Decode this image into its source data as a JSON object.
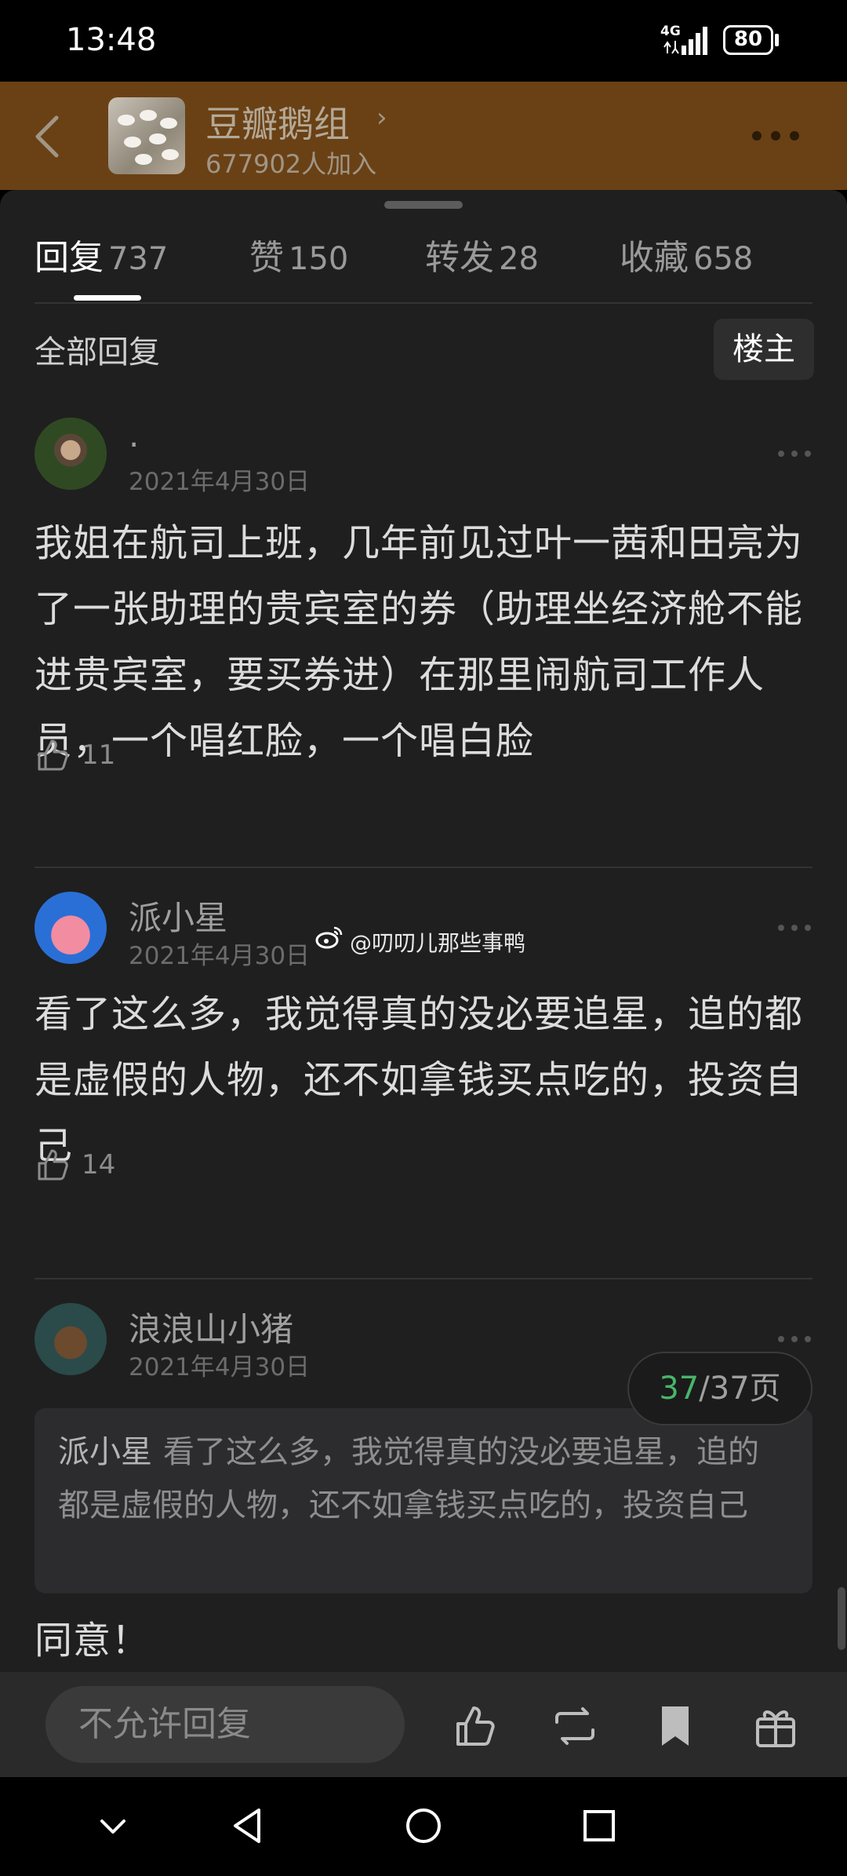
{
  "status_bar": {
    "time": "13:48",
    "network": "4G",
    "battery": "80"
  },
  "group": {
    "name": "豆瓣鹅组",
    "members": "677902人加入"
  },
  "tabs": [
    {
      "label": "回复",
      "count": "737"
    },
    {
      "label": "赞",
      "count": "150"
    },
    {
      "label": "转发",
      "count": "28"
    },
    {
      "label": "收藏",
      "count": "658"
    }
  ],
  "filter": {
    "label": "全部回复",
    "op_button": "楼主"
  },
  "comments": [
    {
      "name": "·",
      "date": "2021年4月30日",
      "text": "我姐在航司上班，几年前见过叶一茜和田亮为了一张助理的贵宾室的券（助理坐经济舱不能进贵宾室，要买券进）在那里闹航司工作人员，一个唱红脸，一个唱白脸",
      "likes": "11"
    },
    {
      "name": "派小星",
      "date": "2021年4月30日",
      "text": "看了这么多，我觉得真的没必要追星，追的都是虚假的人物，还不如拿钱买点吃的，投资自己",
      "likes": "14"
    },
    {
      "name": "浪浪山小猪",
      "date": "2021年4月30日",
      "quote_author": "派小星",
      "quote_text": "看了这么多，我觉得真的没必要追星，追的都是虚假的人物，还不如拿钱买点吃的，投资自己",
      "text": "同意！"
    }
  ],
  "watermark": "@叨叨儿那些事鸭",
  "pagination": {
    "current": "37",
    "total": "/37页"
  },
  "bottom_bar": {
    "reply_placeholder": "不允许回复"
  },
  "colors": {
    "header_bg": "#6a4115",
    "page_current": "#49b56a",
    "sheet_bg": "#1f1f1f"
  },
  "icons": {
    "like": "thumb-up-icon",
    "repost": "repost-icon",
    "bookmark": "bookmark-icon",
    "gift": "gift-icon",
    "more": "more-dots-icon"
  }
}
